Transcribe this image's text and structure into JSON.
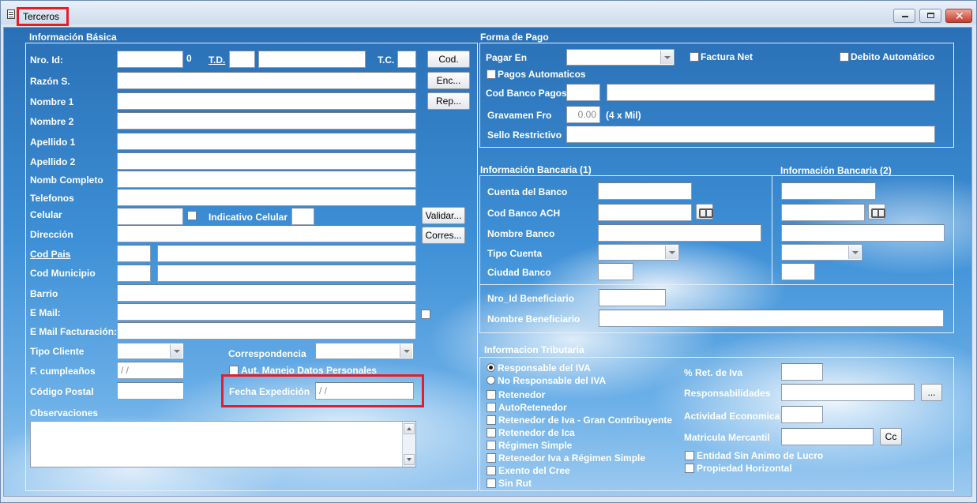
{
  "window": {
    "title": "Terceros"
  },
  "basic": {
    "group_title": "Información Básica",
    "nro_id_label": "Nro. Id:",
    "nro_id_suffix": "0",
    "td_label": "T.D.",
    "tc_label": "T.C.",
    "razon_label": "Razón S.",
    "nombre1_label": "Nombre 1",
    "nombre2_label": "Nombre 2",
    "apellido1_label": "Apellido 1",
    "apellido2_label": "Apellido 2",
    "nomb_completo_label": "Nomb Completo",
    "telefonos_label": "Telefonos",
    "celular_label": "Celular",
    "indicativo_label": "Indicativo Celular",
    "direccion_label": "Dirección",
    "cod_pais_label": "Cod Pais",
    "cod_municipio_label": "Cod Municipio",
    "barrio_label": "Barrio",
    "email_label": "E Mail:",
    "email_fact_label": "E Mail Facturación:",
    "tipo_cliente_label": "Tipo Cliente",
    "correspondencia_label": "Correspondencia",
    "cumple_label": "F. cumpleaños",
    "cumple_value": " / /",
    "aut_label": "Aut. Manejo Datos Personales",
    "codigo_postal_label": "Código Postal",
    "fecha_exp_label": "Fecha Expedición",
    "fecha_exp_value": " / /",
    "observaciones_label": "Observaciones",
    "buttons": {
      "cod": "Cod.",
      "enc": "Enc...",
      "rep": "Rep...",
      "validar": "Validar...",
      "corres": "Corres..."
    }
  },
  "pago": {
    "group_title": "Forma de Pago",
    "pagar_en_label": "Pagar En",
    "factura_net_label": "Factura Net",
    "debito_label": "Debito Automático",
    "pagos_auto_label": "Pagos Automaticos",
    "cod_banco_label": "Cod Banco Pagos",
    "gravamen_label": "Gravamen Fro",
    "gravamen_value": "0.00",
    "gravamen_note": "(4 x Mil)",
    "sello_label": "Sello Restrictivo"
  },
  "bancaria": {
    "title1": "Información Bancaria (1)",
    "title2": "Información Bancaria (2)",
    "cuenta_label": "Cuenta del Banco",
    "cod_ach_label": "Cod Banco ACH",
    "nombre_banco_label": "Nombre Banco",
    "tipo_cuenta_label": "Tipo Cuenta",
    "ciudad_label": "Ciudad Banco",
    "nro_benef_label": "Nro_Id Beneficiario",
    "nombre_benef_label": "Nombre Beneficiario"
  },
  "tributaria": {
    "group_title": "Informacion Tributaria",
    "options": [
      "Responsable del IVA",
      "No Responsable del IVA"
    ],
    "checks": [
      "Retenedor",
      "AutoRetenedor",
      "Retenedor de Iva - Gran Contribuyente",
      "Retenedor de Ica",
      "Régimen Simple",
      "Retenedor Iva a Régimen Simple",
      "Exento del Cree",
      "Sin Rut"
    ],
    "ret_iva_label": "% Ret. de Iva",
    "responsabilidades_label": "Responsabilidades",
    "resp_button": "...",
    "actividad_label": "Actividad Economica",
    "matricula_label": "Matricula Mercantil",
    "cc_button": "Cc",
    "entidad_label": "Entidad Sin Animo de Lucro",
    "propiedad_label": "Propiedad Horizontal"
  }
}
